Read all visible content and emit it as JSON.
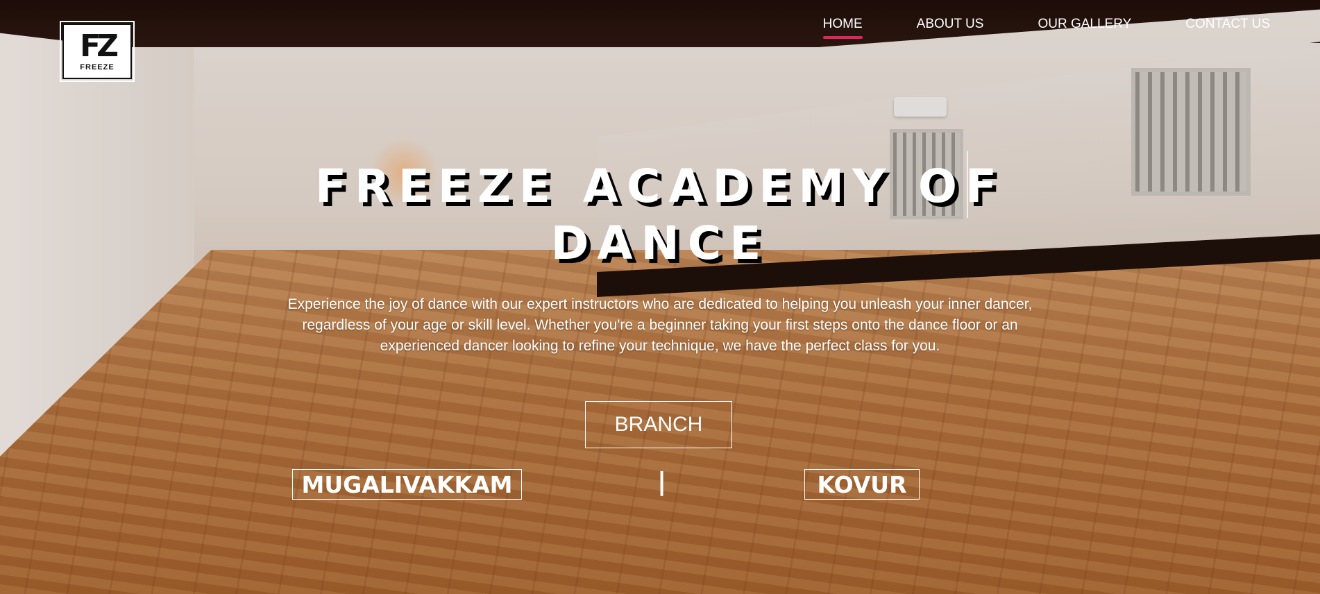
{
  "brand": {
    "logo_mark": "FZ",
    "logo_word": "FREEZE"
  },
  "nav": {
    "items": [
      {
        "label": "HOME",
        "active": true
      },
      {
        "label": "ABOUT US",
        "active": false
      },
      {
        "label": "OUR GALLERY",
        "active": false
      },
      {
        "label": "CONTACT US",
        "active": false
      }
    ]
  },
  "hero": {
    "title_line1": "FREEZE ACADEMY OF",
    "title_line2": "DANCE",
    "description": "Experience the joy of dance with our expert instructors who are dedicated to helping you unleash your inner dancer, regardless of your age or skill level. Whether you're a beginner taking your first steps onto the dance floor or an experienced dancer looking to refine your technique, we have the perfect class for you."
  },
  "branch": {
    "button_label": "BRANCH",
    "locations": [
      "MUGALIVAKKAM",
      "KOVUR"
    ],
    "separator": "|"
  },
  "colors": {
    "accent": "#e0245e",
    "text": "#ffffff"
  }
}
